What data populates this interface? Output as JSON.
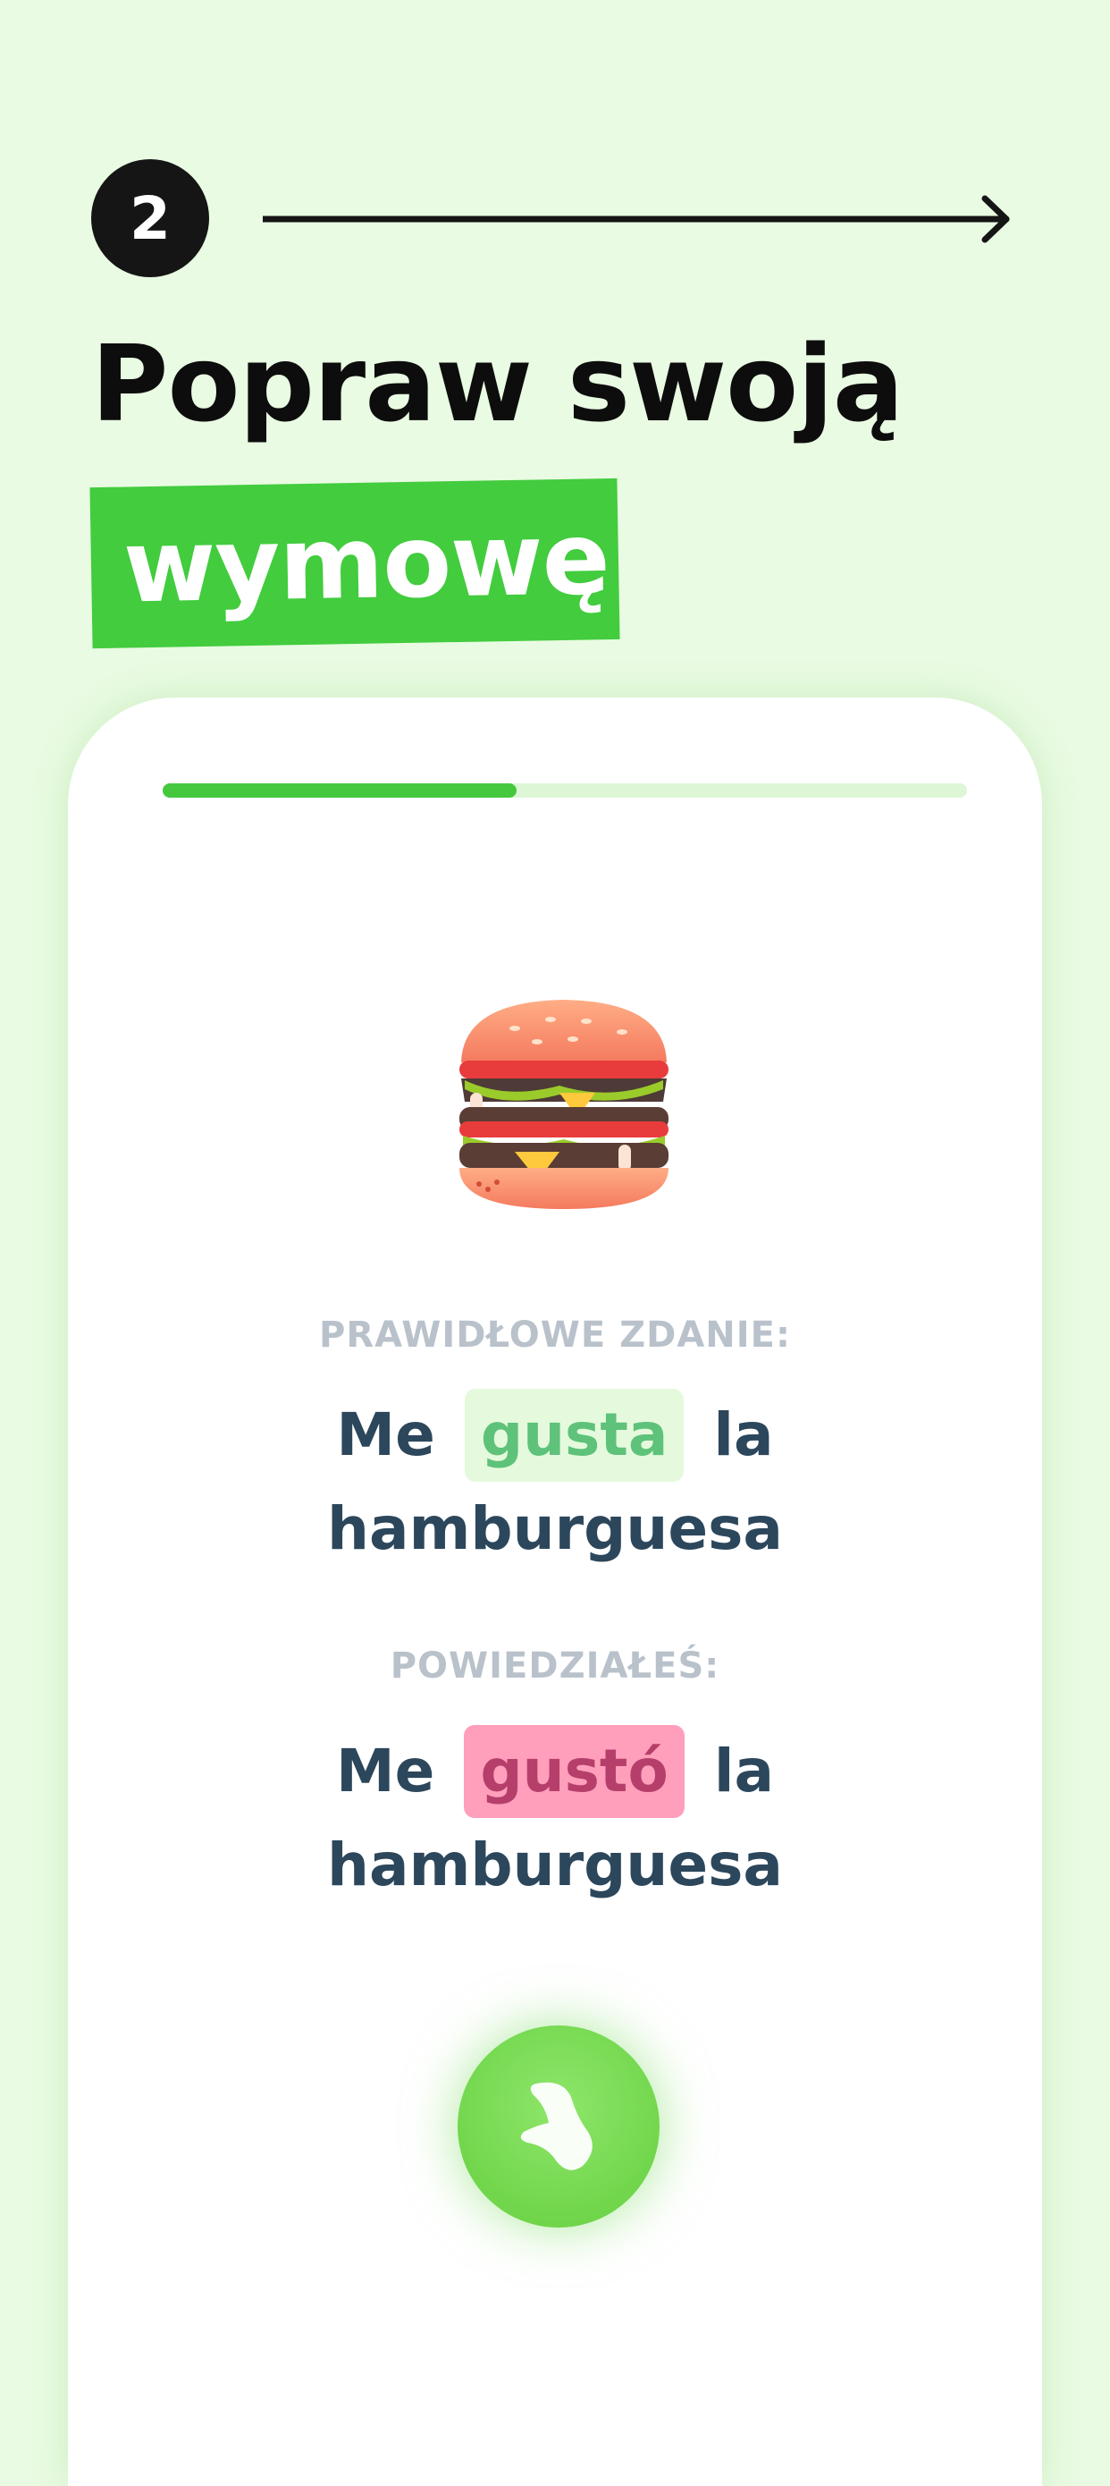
{
  "step": {
    "number": "2"
  },
  "heading": {
    "line1": "Popraw swoją",
    "highlight": "wymowę"
  },
  "card": {
    "progress": 0.44,
    "image": "hamburger-emoji",
    "correct": {
      "label": "PRAWIDŁOWE ZDANIE:",
      "before": "Me",
      "highlight": "gusta",
      "after": "la",
      "line2": "hamburguesa",
      "highlight_color": "#5ec27a"
    },
    "spoken": {
      "label": "POWIEDZIAŁEŚ:",
      "before": "Me",
      "highlight": "gustó",
      "after": "la",
      "line2": "hamburguesa",
      "highlight_color": "#b53f6a"
    },
    "mic_button": {
      "icon": "voice-icon",
      "color": "#71d64c"
    }
  },
  "colors": {
    "background": "#e9fbe2",
    "accent": "#42cc3e",
    "text": "#2c475c"
  }
}
